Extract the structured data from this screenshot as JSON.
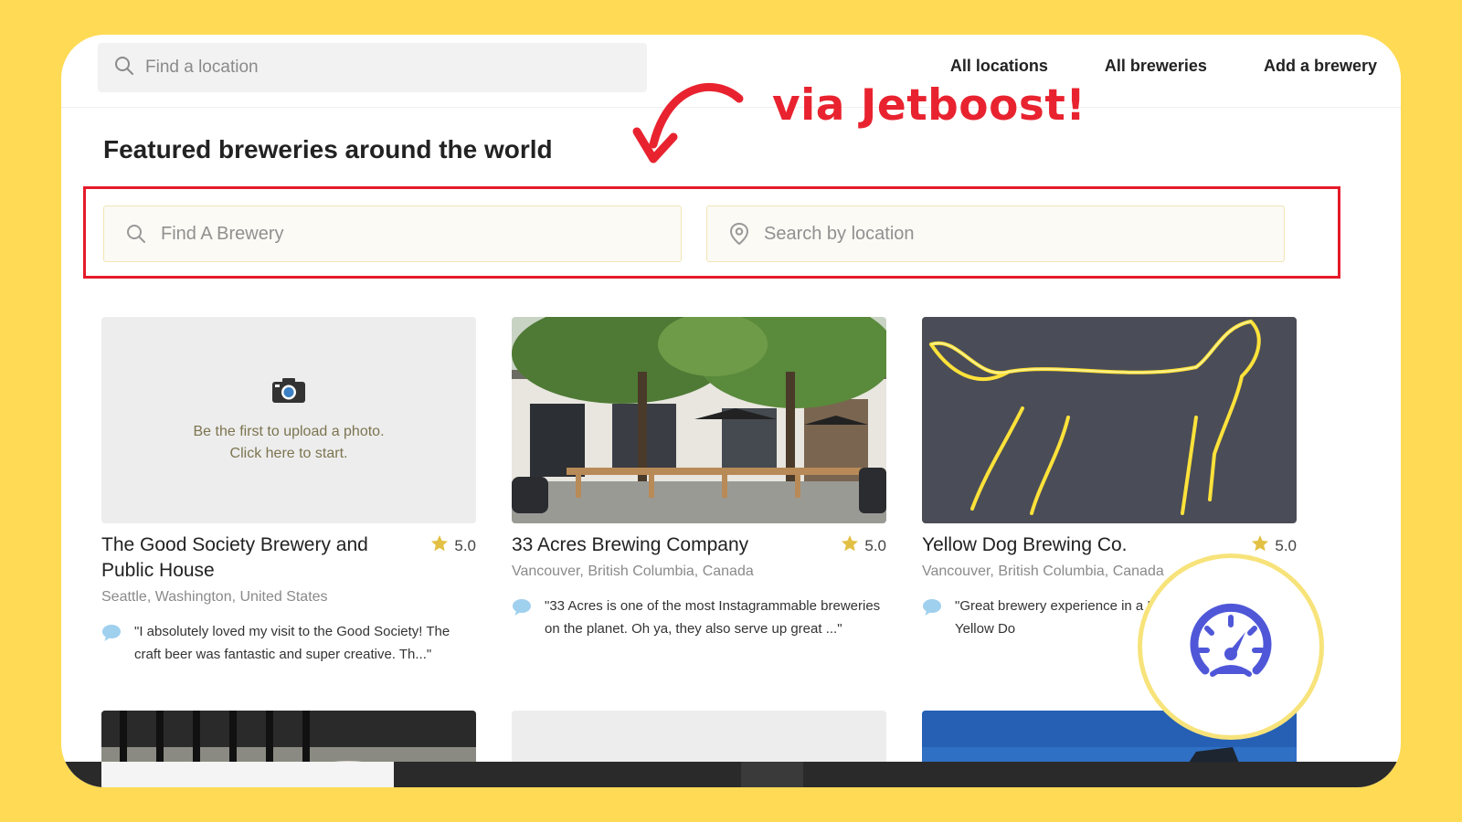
{
  "topbar": {
    "search_placeholder": "Find a location",
    "nav": [
      "All locations",
      "All breweries",
      "Add a brewery"
    ]
  },
  "annotation": {
    "text": "via Jetboost!",
    "color": "#E8232F"
  },
  "heading": "Featured breweries around the world",
  "filters": {
    "brewery_placeholder": "Find A Brewery",
    "location_placeholder": "Search by location"
  },
  "cards": [
    {
      "title": "The Good Society Brewery and Public House",
      "rating": "5.0",
      "location": "Seattle, Washington, United States",
      "review": "\"I absolutely loved my visit to the Good Society! The craft beer was fantastic and super creative. Th...\"",
      "photo_placeholder": "Be the first to upload a photo. Click here to start."
    },
    {
      "title": "33 Acres Brewing Company",
      "rating": "5.0",
      "location": "Vancouver, British Columbia, Canada",
      "review": "\"33 Acres is one of the most Instagrammable breweries on the planet. Oh ya, they also serve up great ...\""
    },
    {
      "title": "Yellow Dog Brewing Co.",
      "rating": "5.0",
      "location": "Vancouver, British Columbia, Canada",
      "review": "\"Great brewery experience in a Every beer I tried at Yellow Do"
    }
  ],
  "colors": {
    "background": "#FFDA55",
    "highlight_border": "#E51A2A",
    "star": "#E2C044",
    "bubble": "#9FD0EE",
    "gauge": "#4F57D8"
  }
}
